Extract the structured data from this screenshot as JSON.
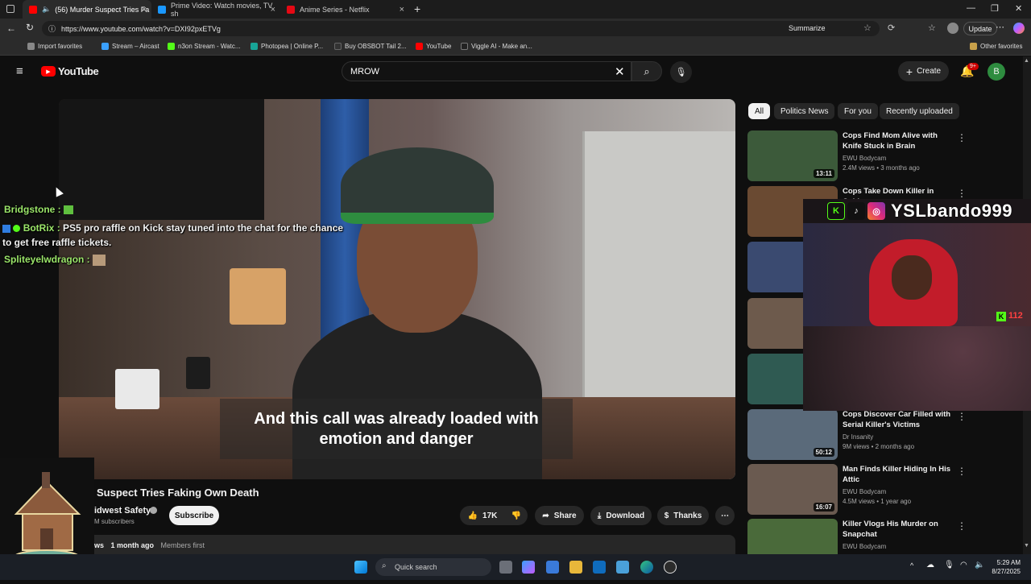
{
  "browser": {
    "tabs": [
      {
        "title": "(56) Murder Suspect Tries Fa",
        "color": "#ff0000"
      },
      {
        "title": "Prime Video: Watch movies, TV sh",
        "color": "#1a98ff"
      },
      {
        "title": "Anime Series - Netflix",
        "color": "#e50914"
      }
    ],
    "url": "https://www.youtube.com/watch?v=DXI92pxETVg",
    "summarize_label": "Summarize",
    "update_label": "Update",
    "bookmarks": [
      {
        "label": "Import favorites",
        "color": "#888888"
      },
      {
        "label": "Stream – Aircast",
        "color": "#3aa0ff"
      },
      {
        "label": "n3on Stream - Watc...",
        "color": "#53fc18"
      },
      {
        "label": "Photopea | Online P...",
        "color": "#18a497"
      },
      {
        "label": "Buy OBSBOT Tail 2...",
        "color": "#333333"
      },
      {
        "label": "YouTube",
        "color": "#ff0000"
      },
      {
        "label": "Viggle AI - Make an...",
        "color": "#222222"
      }
    ],
    "other_favorites": "Other favorites"
  },
  "youtube": {
    "logo_text": "YouTube",
    "search_value": "MROW",
    "create_label": "Create",
    "notif_badge": "9+",
    "avatar_letter": "B",
    "caption_lines": [
      "And this call was already loaded with",
      "emotion and danger"
    ],
    "video_title": "Suspect Tries Faking Own Death",
    "channel_name": "idwest Safety",
    "subscribers": "M subscribers",
    "subscribe_label": "Subscribe",
    "likes": "17K",
    "share_label": "Share",
    "download_label": "Download",
    "thanks_label": "Thanks",
    "views_partial": "ws",
    "upload_time": "1 month ago",
    "members_first": "Members first"
  },
  "chat": [
    {
      "user": "Bridgstone :",
      "text": ""
    },
    {
      "user": "BotRix :",
      "text": "PS5 pro raffle on Kick stay tuned into the chat for the chance to get free raffle tickets."
    },
    {
      "user": "Spliteyelwdragon :",
      "text": ""
    }
  ],
  "sidebar": {
    "chips": [
      "All",
      "Politics News",
      "For you",
      "Recently uploaded"
    ],
    "recs": [
      {
        "title": "Cops Find Mom Alive with Knife Stuck in Brain",
        "channel": "EWU Bodycam",
        "meta": "2.4M views • 3 months ago",
        "duration": "13:11",
        "thumb": "#3c5a3a"
      },
      {
        "title": "Cops Take Down Killer in Cold-",
        "channel": "",
        "meta": "",
        "duration": "",
        "thumb": "#6a4a32"
      },
      {
        "title": "",
        "channel": "",
        "meta": "",
        "duration": "",
        "thumb": "#3a4a70"
      },
      {
        "title": "",
        "channel": "",
        "meta": "",
        "duration": "",
        "thumb": "#6d5a4c"
      },
      {
        "title": "",
        "channel": "",
        "meta": "",
        "duration": "",
        "thumb": "#2f5a52"
      },
      {
        "title": "Cops Discover Car Filled with Serial Killer's Victims",
        "channel": "Dr Insanity",
        "meta": "9M views • 2 months ago",
        "duration": "50:12",
        "thumb": "#5a6a7a"
      },
      {
        "title": "Man Finds Killer Hiding In His Attic",
        "channel": "EWU Bodycam",
        "meta": "4.5M views • 1 year ago",
        "duration": "16:07",
        "thumb": "#6a5a50"
      },
      {
        "title": "Killer Vlogs His Murder on Snapchat",
        "channel": "EWU Bodycam",
        "meta": "",
        "duration": "",
        "thumb": "#4a6a3a"
      }
    ]
  },
  "overlay": {
    "streamer_name": "YSLbando999",
    "viewer_count": "112"
  },
  "taskbar": {
    "search_placeholder": "Quick search",
    "time": "5:29 AM",
    "date": "8/27/2025"
  }
}
